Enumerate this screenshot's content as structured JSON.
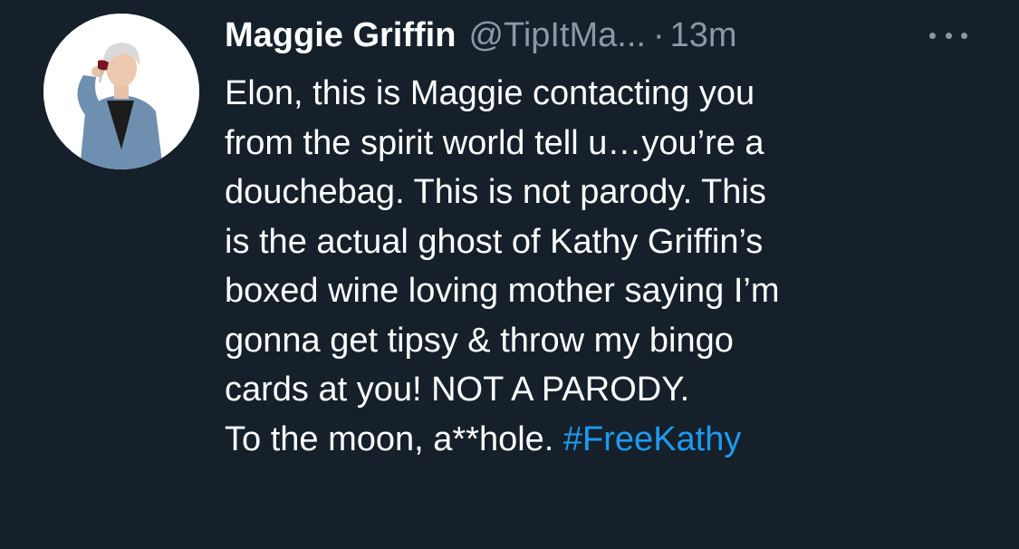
{
  "tweet": {
    "author": {
      "display_name": "Maggie Griffin",
      "handle": "@TipItMa...",
      "separator": "·",
      "time": "13m",
      "avatar_icon": "profile-photo-woman-drinking-wine-icon"
    },
    "more_icon": "more-options-icon",
    "body_lines": [
      "Elon, this is Maggie contacting you",
      "from the spirit world tell u…you’re a",
      "douchebag. This is not parody. This",
      "is the actual ghost of Kathy Griffin’s",
      "boxed wine loving mother saying I’m",
      "gonna get tipsy & throw my bingo",
      "cards at you! NOT A PARODY."
    ],
    "last_line_text": "To the moon, a**hole. ",
    "hashtag": "#FreeKathy"
  },
  "colors": {
    "background": "#15202b",
    "text": "#ffffff",
    "secondary_text": "#8b98a5",
    "link": "#1d9bf0"
  }
}
